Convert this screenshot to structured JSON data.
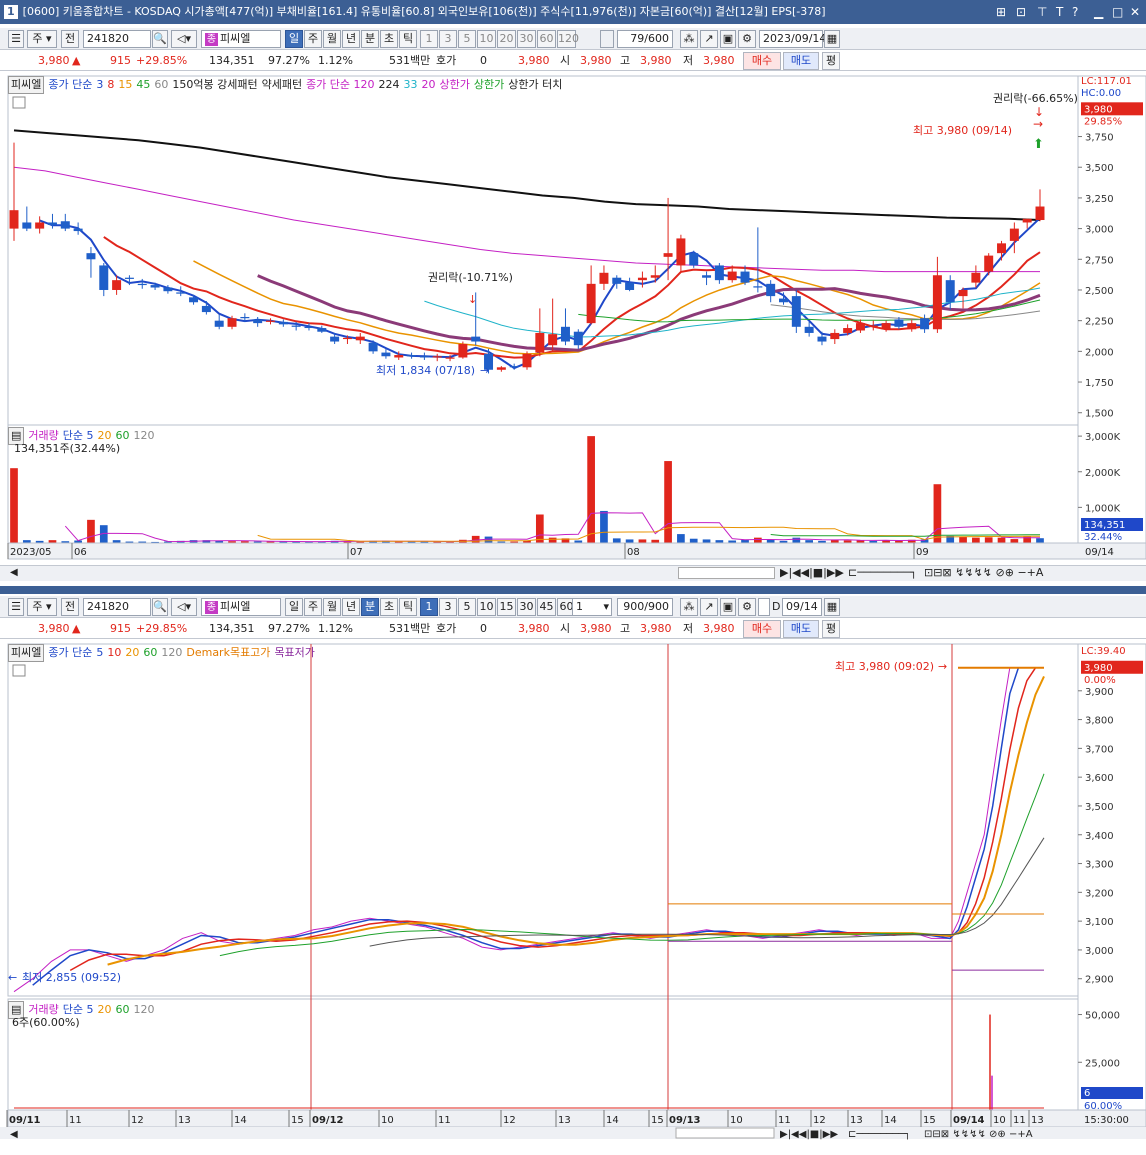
{
  "window": {
    "number": "1",
    "title": "[0600] 키움종합차트 - KOSDAQ 시가총액[477(억)] 부채비율[161.4] 유통비율[60.8] 외국인보유[106(천)] 주식수[11,976(천)] 자본금[60(억)] 결산[12월] EPS[-378]",
    "controls": [
      "⊞",
      "⊡",
      "⊤",
      "T",
      "?",
      "▁",
      "□",
      "✕"
    ]
  },
  "panel1": {
    "toolbar": {
      "market": "주",
      "prev": "전",
      "code": "241820",
      "name": "피씨엘",
      "periods": [
        "일",
        "주",
        "월",
        "년",
        "분",
        "초",
        "틱"
      ],
      "selected_period": "일",
      "numbers": [
        "1",
        "3",
        "5",
        "10",
        "20",
        "30",
        "60",
        "120"
      ],
      "count": "79/600",
      "date": "2023/09/14"
    },
    "quote": {
      "price": "3,980",
      "arrow": "▲",
      "change": "915",
      "change_pct": "+29.85%",
      "volume": "134,351",
      "vol_ratio": "97.27%",
      "turnover": "1.12%",
      "amount": "531백만",
      "hoga_label": "호가",
      "hoga": "0",
      "ask": "3,980",
      "open_label": "시",
      "open": "3,980",
      "high_label": "고",
      "high": "3,980",
      "low_label": "저",
      "low": "3,980",
      "buy": "매수",
      "sell": "매도",
      "eval": "평"
    },
    "legend": [
      {
        "t": "피씨엘",
        "c": "#222",
        "box": true
      },
      {
        "t": "종가 단순",
        "c": "#1f48c9"
      },
      {
        "t": "3",
        "c": "#1f48c9"
      },
      {
        "t": "8",
        "c": "#e1261c"
      },
      {
        "t": "15",
        "c": "#e99300"
      },
      {
        "t": "45",
        "c": "#1ea12b"
      },
      {
        "t": "60",
        "c": "#888"
      },
      {
        "t": "150억봉 강세패턴",
        "c": "#222"
      },
      {
        "t": "약세패턴",
        "c": "#222"
      },
      {
        "t": "종가 단순 120",
        "c": "#c420c4"
      },
      {
        "t": "224",
        "c": "#222"
      },
      {
        "t": "33",
        "c": "#1fb3c9"
      },
      {
        "t": "20",
        "c": "#c420c4"
      },
      {
        "t": "상한가",
        "c": "#c420c4"
      },
      {
        "t": "상한가",
        "c": "#1ea12b"
      },
      {
        "t": "상한가 터치",
        "c": "#222"
      }
    ],
    "axis_top": {
      "lc": "LC:117.01",
      "hc": "HC:0.00",
      "price_tag": "3,980",
      "pct_tag": "29.85%"
    },
    "annotations": {
      "rights1": "권리락(-66.65%)",
      "high": "최고 3,980 (09/14)",
      "rights2": "권리락(-10.71%)",
      "low": "최저 1,834 (07/18)"
    },
    "vol_legend": {
      "label": "거래량",
      "ma": "단순 5",
      "m20": "20",
      "m60": "60",
      "m120": "120",
      "value": "134,351주(32.44%)",
      "tag": "134,351",
      "tag_pct": "32.44%"
    },
    "x_labels": [
      "2023/05",
      "06",
      "07",
      "08",
      "09"
    ],
    "x_last": "09/14"
  },
  "panel2": {
    "toolbar": {
      "market": "주",
      "prev": "전",
      "code": "241820",
      "name": "피씨엘",
      "periods": [
        "일",
        "주",
        "월",
        "년",
        "분",
        "초",
        "틱"
      ],
      "selected_period": "분",
      "numbers": [
        "1",
        "3",
        "5",
        "10",
        "15",
        "30",
        "45",
        "60"
      ],
      "selected_number": "1",
      "count_sel": "1",
      "count": "900/900",
      "date": "09/14",
      "dflag": "D"
    },
    "quote": {
      "price": "3,980",
      "arrow": "▲",
      "change": "915",
      "change_pct": "+29.85%",
      "volume": "134,351",
      "vol_ratio": "97.27%",
      "turnover": "1.12%",
      "amount": "531백만",
      "hoga_label": "호가",
      "hoga": "0",
      "ask": "3,980",
      "open_label": "시",
      "open": "3,980",
      "high_label": "고",
      "high": "3,980",
      "low_label": "저",
      "low": "3,980",
      "buy": "매수",
      "sell": "매도",
      "eval": "평"
    },
    "legend": [
      {
        "t": "피씨엘",
        "c": "#222",
        "box": true
      },
      {
        "t": "종가 단순",
        "c": "#1f48c9"
      },
      {
        "t": "5",
        "c": "#1f48c9"
      },
      {
        "t": "10",
        "c": "#e1261c"
      },
      {
        "t": "20",
        "c": "#e99300"
      },
      {
        "t": "60",
        "c": "#1ea12b"
      },
      {
        "t": "120",
        "c": "#888"
      },
      {
        "t": "Demark목표고가",
        "c": "#e37b00"
      },
      {
        "t": "목표저가",
        "c": "#8b2b9e"
      }
    ],
    "axis_top": {
      "lc": "LC:39.40",
      "price_tag": "3,980",
      "pct_tag": "0.00%"
    },
    "annotations": {
      "high": "최고 3,980 (09:02)",
      "low": "최저 2,855 (09:52)"
    },
    "vol_legend": {
      "label": "거래량",
      "ma": "단순 5",
      "m20": "20",
      "m60": "60",
      "m120": "120",
      "value": "6주(60.00%)",
      "tag": "6",
      "tag_pct": "60.00%"
    },
    "x_labels": [
      "09/11",
      "11",
      "12",
      "13",
      "14",
      "15",
      "09/12",
      "10",
      "11",
      "12",
      "13",
      "14",
      "15",
      "09/13",
      "10",
      "11",
      "12",
      "13",
      "14",
      "15",
      "09/14",
      "10",
      "11",
      "13"
    ],
    "x_last": "15:30:00"
  },
  "chart_data": [
    {
      "type": "candlestick",
      "title": "피씨엘 일봉",
      "y_ticks": [
        "3,750",
        "3,500",
        "3,250",
        "3,000",
        "2,750",
        "2,500",
        "2,250",
        "2,000",
        "1,750",
        "1,500"
      ],
      "ylim": [
        1400,
        3950
      ],
      "ohlc": [
        [
          3000,
          3700,
          2900,
          3150
        ],
        [
          3050,
          3180,
          2980,
          3000
        ],
        [
          3000,
          3100,
          2960,
          3050
        ],
        [
          3050,
          3120,
          3000,
          3030
        ],
        [
          3060,
          3120,
          2980,
          3000
        ],
        [
          3000,
          3050,
          2950,
          2980
        ],
        [
          2800,
          2850,
          2600,
          2750
        ],
        [
          2700,
          2720,
          2450,
          2500
        ],
        [
          2500,
          2620,
          2460,
          2580
        ],
        [
          2600,
          2620,
          2540,
          2590
        ],
        [
          2550,
          2590,
          2510,
          2540
        ],
        [
          2540,
          2560,
          2500,
          2520
        ],
        [
          2520,
          2540,
          2470,
          2490
        ],
        [
          2480,
          2530,
          2450,
          2470
        ],
        [
          2440,
          2460,
          2380,
          2400
        ],
        [
          2370,
          2410,
          2300,
          2320
        ],
        [
          2250,
          2300,
          2180,
          2200
        ],
        [
          2200,
          2290,
          2180,
          2270
        ],
        [
          2280,
          2310,
          2240,
          2270
        ],
        [
          2260,
          2280,
          2200,
          2230
        ],
        [
          2240,
          2270,
          2220,
          2250
        ],
        [
          2240,
          2260,
          2200,
          2220
        ],
        [
          2210,
          2240,
          2170,
          2200
        ],
        [
          2200,
          2230,
          2170,
          2190
        ],
        [
          2190,
          2210,
          2150,
          2160
        ],
        [
          2120,
          2150,
          2060,
          2080
        ],
        [
          2100,
          2130,
          2060,
          2110
        ],
        [
          2090,
          2150,
          2060,
          2120
        ],
        [
          2070,
          2090,
          1980,
          2000
        ],
        [
          1990,
          2020,
          1940,
          1960
        ],
        [
          1950,
          2000,
          1930,
          1970
        ],
        [
          1970,
          1990,
          1940,
          1960
        ],
        [
          1960,
          1990,
          1930,
          1950
        ],
        [
          1950,
          1980,
          1920,
          1960
        ],
        [
          1940,
          1970,
          1920,
          1950
        ],
        [
          1950,
          2080,
          1940,
          2060
        ],
        [
          2120,
          2480,
          2050,
          2080
        ],
        [
          1980,
          2020,
          1820,
          1850
        ],
        [
          1850,
          1880,
          1834,
          1870
        ],
        [
          1880,
          1900,
          1850,
          1870
        ],
        [
          1870,
          2000,
          1850,
          1980
        ],
        [
          1990,
          2350,
          1960,
          2150
        ],
        [
          2050,
          2430,
          2000,
          2140
        ],
        [
          2200,
          2350,
          2050,
          2080
        ],
        [
          2160,
          2180,
          2020,
          2050
        ],
        [
          2230,
          2700,
          2220,
          2550
        ],
        [
          2550,
          2700,
          2500,
          2640
        ],
        [
          2600,
          2620,
          2510,
          2550
        ],
        [
          2560,
          2600,
          2490,
          2500
        ],
        [
          2580,
          2650,
          2520,
          2600
        ],
        [
          2600,
          2700,
          2560,
          2620
        ],
        [
          2770,
          3250,
          2580,
          2800
        ],
        [
          2700,
          2950,
          2650,
          2920
        ],
        [
          2800,
          2820,
          2680,
          2700
        ],
        [
          2620,
          2650,
          2540,
          2600
        ],
        [
          2700,
          2720,
          2550,
          2580
        ],
        [
          2580,
          2700,
          2560,
          2650
        ],
        [
          2650,
          2700,
          2540,
          2560
        ],
        [
          2530,
          3010,
          2480,
          2520
        ],
        [
          2550,
          2580,
          2400,
          2450
        ],
        [
          2430,
          2480,
          2380,
          2400
        ],
        [
          2450,
          2500,
          2150,
          2200
        ],
        [
          2200,
          2240,
          2120,
          2150
        ],
        [
          2120,
          2160,
          2050,
          2080
        ],
        [
          2100,
          2180,
          2060,
          2150
        ],
        [
          2150,
          2220,
          2130,
          2190
        ],
        [
          2170,
          2260,
          2150,
          2230
        ],
        [
          2200,
          2250,
          2170,
          2210
        ],
        [
          2180,
          2250,
          2160,
          2230
        ],
        [
          2260,
          2280,
          2180,
          2200
        ],
        [
          2180,
          2260,
          2160,
          2230
        ],
        [
          2270,
          2300,
          2150,
          2180
        ],
        [
          2180,
          2770,
          2150,
          2620
        ],
        [
          2580,
          2620,
          2340,
          2400
        ],
        [
          2450,
          2520,
          2350,
          2500
        ],
        [
          2560,
          2700,
          2520,
          2640
        ],
        [
          2650,
          2800,
          2620,
          2780
        ],
        [
          2800,
          2900,
          2740,
          2880
        ],
        [
          2900,
          3050,
          2800,
          3000
        ],
        [
          3050,
          3080,
          3000,
          3080
        ],
        [
          3070,
          3320,
          3060,
          3180
        ]
      ],
      "ma_long": [
        3800,
        3780,
        3760,
        3740,
        3720,
        3690,
        3660,
        3620,
        3580,
        3540,
        3500,
        3460,
        3420,
        3390,
        3360,
        3330,
        3300,
        3270,
        3250,
        3220,
        3200,
        3190,
        3180,
        3160,
        3150,
        3140,
        3130,
        3120,
        3110,
        3100,
        3090,
        3085,
        3080,
        3070
      ],
      "ma_120": [
        3500,
        3470,
        3420,
        3370,
        3320,
        3270,
        3220,
        3170,
        3120,
        3070,
        3030,
        2990,
        2950,
        2910,
        2870,
        2830,
        2800,
        2780,
        2760,
        2740,
        2720,
        2710,
        2700,
        2690,
        2680,
        2670,
        2660,
        2660,
        2650,
        2650,
        2650,
        2650,
        2650,
        2650
      ],
      "volume": {
        "ylim": [
          0,
          3200000
        ],
        "y_ticks": [
          "3,000K",
          "2,000K",
          "1,000K"
        ],
        "bars": [
          [
            2100000,
            1
          ],
          [
            80000,
            0
          ],
          [
            60000,
            0
          ],
          [
            80000,
            1
          ],
          [
            50000,
            0
          ],
          [
            70000,
            0
          ],
          [
            650000,
            1
          ],
          [
            500000,
            0
          ],
          [
            80000,
            0
          ],
          [
            40000,
            0
          ],
          [
            40000,
            0
          ],
          [
            30000,
            0
          ],
          [
            40000,
            0
          ],
          [
            60000,
            0
          ],
          [
            80000,
            0
          ],
          [
            80000,
            0
          ],
          [
            60000,
            0
          ],
          [
            50000,
            1
          ],
          [
            50000,
            1
          ],
          [
            40000,
            0
          ],
          [
            40000,
            1
          ],
          [
            40000,
            0
          ],
          [
            40000,
            0
          ],
          [
            40000,
            0
          ],
          [
            40000,
            0
          ],
          [
            60000,
            0
          ],
          [
            40000,
            1
          ],
          [
            40000,
            1
          ],
          [
            60000,
            0
          ],
          [
            60000,
            0
          ],
          [
            40000,
            1
          ],
          [
            40000,
            0
          ],
          [
            40000,
            0
          ],
          [
            40000,
            1
          ],
          [
            40000,
            1
          ],
          [
            90000,
            1
          ],
          [
            200000,
            1
          ],
          [
            180000,
            0
          ],
          [
            40000,
            0
          ],
          [
            40000,
            1
          ],
          [
            70000,
            1
          ],
          [
            800000,
            1
          ],
          [
            150000,
            1
          ],
          [
            130000,
            1
          ],
          [
            70000,
            0
          ],
          [
            3000000,
            1
          ],
          [
            900000,
            0
          ],
          [
            130000,
            0
          ],
          [
            100000,
            0
          ],
          [
            100000,
            1
          ],
          [
            90000,
            1
          ],
          [
            2300000,
            1
          ],
          [
            250000,
            0
          ],
          [
            120000,
            0
          ],
          [
            100000,
            0
          ],
          [
            80000,
            0
          ],
          [
            70000,
            0
          ],
          [
            90000,
            0
          ],
          [
            150000,
            1
          ],
          [
            100000,
            0
          ],
          [
            60000,
            0
          ],
          [
            150000,
            0
          ],
          [
            80000,
            0
          ],
          [
            60000,
            0
          ],
          [
            90000,
            1
          ],
          [
            70000,
            1
          ],
          [
            80000,
            1
          ],
          [
            60000,
            0
          ],
          [
            80000,
            1
          ],
          [
            60000,
            1
          ],
          [
            90000,
            1
          ],
          [
            100000,
            0
          ],
          [
            1650000,
            1
          ],
          [
            200000,
            0
          ],
          [
            180000,
            1
          ],
          [
            150000,
            1
          ],
          [
            160000,
            1
          ],
          [
            150000,
            1
          ],
          [
            110000,
            1
          ],
          [
            180000,
            1
          ],
          [
            134351,
            0
          ]
        ]
      }
    },
    {
      "type": "line",
      "title": "피씨엘 1분봉",
      "y_ticks": [
        "3,900",
        "3,800",
        "3,700",
        "3,600",
        "3,500",
        "3,400",
        "3,300",
        "3,200",
        "3,100",
        "3,000",
        "2,900"
      ],
      "ylim": [
        2840,
        4000
      ],
      "close": [
        2855,
        2900,
        2960,
        3000,
        3000,
        2980,
        2960,
        2980,
        3000,
        3040,
        3060,
        3030,
        3020,
        3030,
        3040,
        3050,
        3070,
        3080,
        3100,
        3110,
        3100,
        3090,
        3080,
        3060,
        3040,
        3010,
        3000,
        3010,
        3020,
        3030,
        3040,
        3050,
        3060,
        3050,
        3040,
        3050,
        3060,
        3070,
        3060,
        3050,
        3040,
        3050,
        3060,
        3070,
        3060,
        3050,
        3060,
        3050,
        3060,
        3040,
        3040,
        3100,
        3200,
        3300,
        3400,
        3600,
        3800,
        3980,
        3980,
        3980,
        3980,
        3980
      ],
      "demark_high": 3160,
      "demark_low": 2930,
      "volume": {
        "ylim": [
          0,
          55000
        ],
        "y_ticks": [
          "50,000",
          "25,000"
        ]
      }
    }
  ]
}
